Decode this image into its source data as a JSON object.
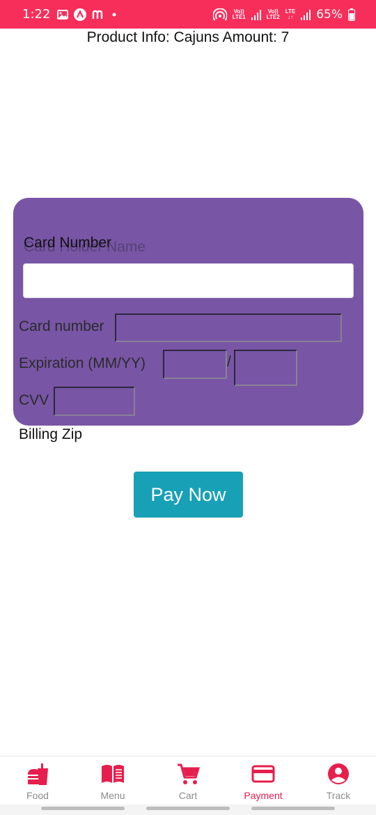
{
  "status_bar": {
    "time": "1:22",
    "left_icons": [
      "image-icon",
      "app-a-icon",
      "m-icon",
      "dot-icon"
    ],
    "sim1_label_top": "Vo))",
    "sim1_label_bottom": "LTE1",
    "sim2_label_top": "Vo))",
    "sim2_label_bottom": "LTE2",
    "lte_label_top": "LTE",
    "lte_label_bottom": "↓↑",
    "battery": "65%",
    "color": "#f72e5a"
  },
  "product_info": "Product Info: Cajuns Amount: 7",
  "card_form": {
    "card_number_heading": "Card Number",
    "name_placeholder": "Card Holder Name",
    "card_number_label": "Card number",
    "expiration_label": "Expiration (MM/YY)",
    "slash": "/",
    "cvv_label": "CVV",
    "panel_color": "#7855a5"
  },
  "billing_zip_label": "Billing Zip",
  "pay_button": {
    "label": "Pay Now",
    "color": "#18a0b6"
  },
  "bottom_nav": {
    "items": [
      {
        "label": "Food",
        "icon": "food-icon",
        "active": false
      },
      {
        "label": "Menu",
        "icon": "menu-book-icon",
        "active": false
      },
      {
        "label": "Cart",
        "icon": "cart-icon",
        "active": false
      },
      {
        "label": "Payment",
        "icon": "credit-card-icon",
        "active": true
      },
      {
        "label": "Track",
        "icon": "account-circle-icon",
        "active": false
      }
    ],
    "icon_color": "#e61e4d"
  }
}
